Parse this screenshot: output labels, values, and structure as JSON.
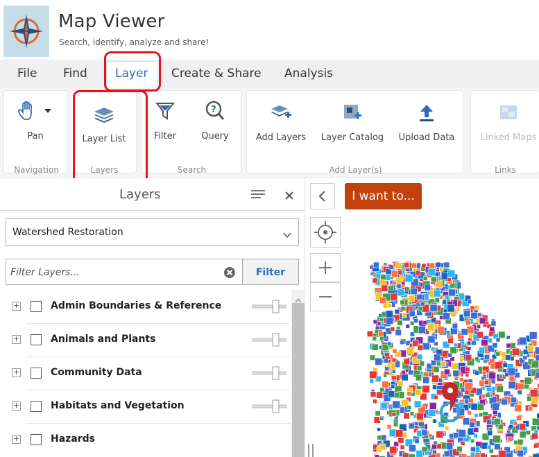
{
  "header": {
    "title": "Map Viewer",
    "subtitle": "Search, identify, analyze and share!"
  },
  "menu": {
    "tabs": [
      "File",
      "Find",
      "Layer",
      "Create & Share",
      "Analysis"
    ],
    "active": "Layer"
  },
  "ribbon": {
    "pan": "Pan",
    "layer_list": "Layer List",
    "filter": "Filter",
    "query": "Query",
    "add_layers": "Add Layers",
    "layer_catalog": "Layer Catalog",
    "upload_data": "Upload Data",
    "linked_maps": "Linked Maps",
    "groups": {
      "navigation": "Navigation",
      "layers": "Layers",
      "search": "Search",
      "add_layers": "Add Layer(s)",
      "links": "Links"
    }
  },
  "panel": {
    "title": "Layers",
    "theme_select": "Watershed Restoration",
    "filter_placeholder": "Filter Layers...",
    "filter_button": "Filter",
    "layers": [
      {
        "label": "Admin Boundaries & Reference"
      },
      {
        "label": "Animals and Plants"
      },
      {
        "label": "Community Data"
      },
      {
        "label": "Habitats and Vegetation"
      },
      {
        "label": "Hazards"
      }
    ]
  },
  "map": {
    "i_want_to": "I want to..."
  },
  "colors": {
    "highlight": "#e8121b",
    "accent_blue": "#2a6ebb",
    "i_want_bg": "#c2410c"
  }
}
